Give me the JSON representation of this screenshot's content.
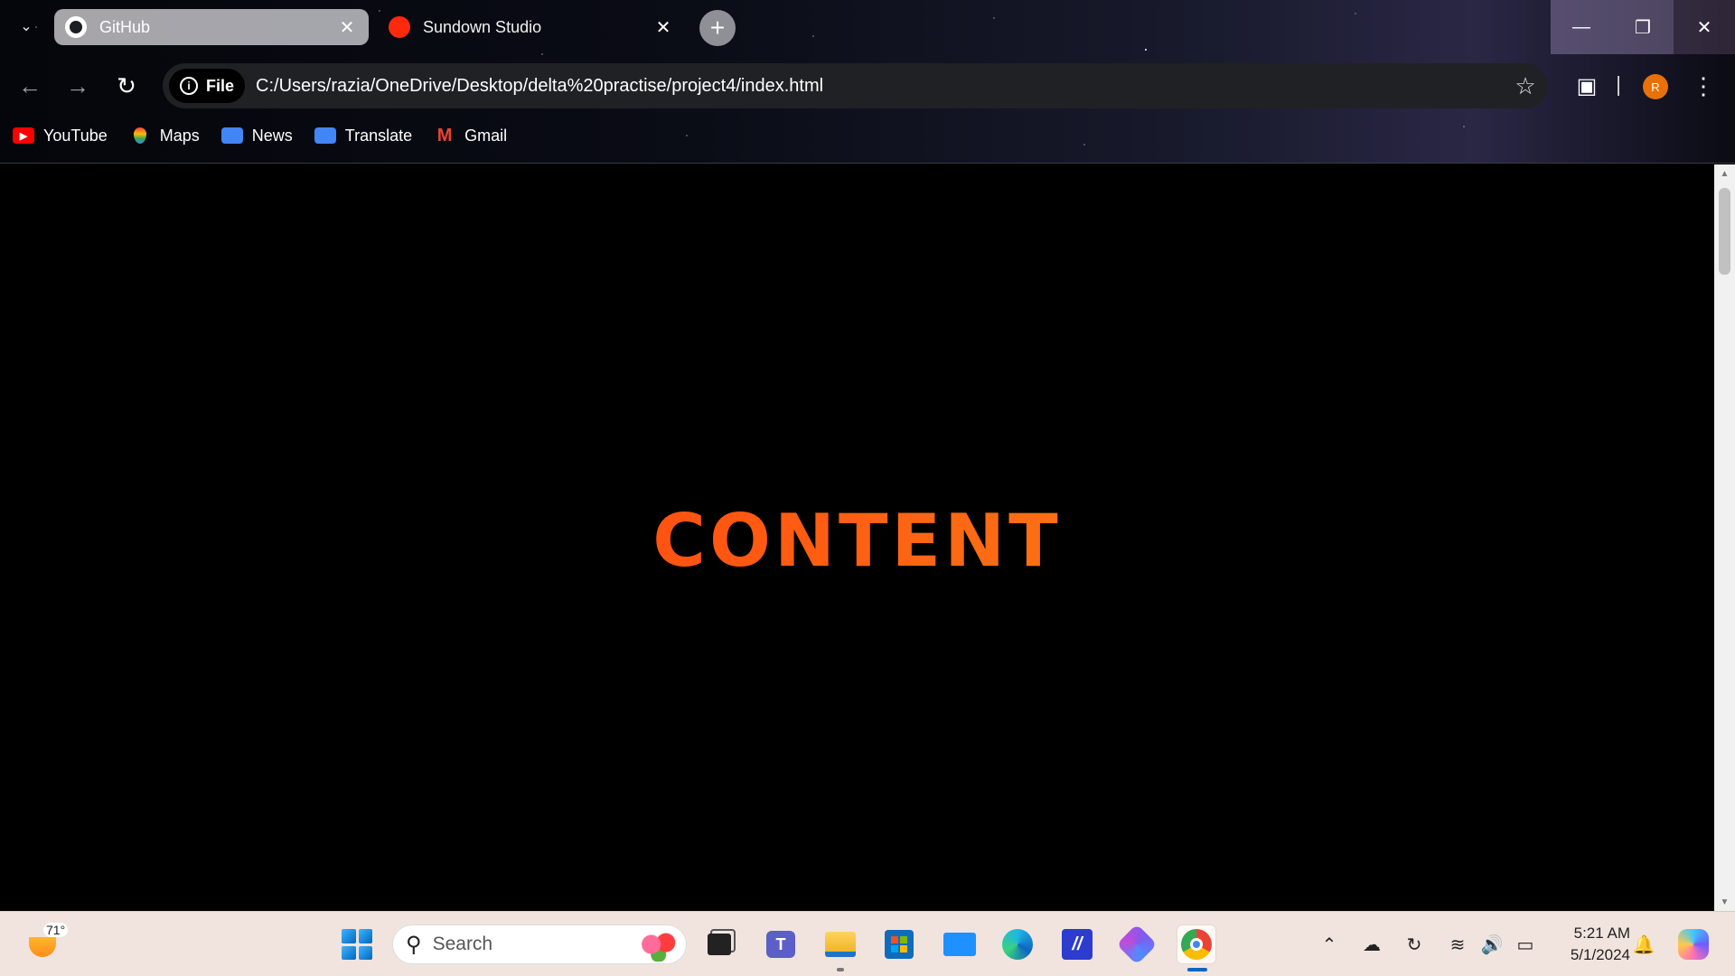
{
  "browser": {
    "tabs": [
      {
        "title": "GitHub",
        "active": true,
        "icon": "github-icon"
      },
      {
        "title": "Sundown Studio",
        "active": false,
        "icon": "red-circle-icon"
      }
    ],
    "address": {
      "scheme_label": "File",
      "url": "C:/Users/razia/OneDrive/Desktop/delta%20practise/project4/index.html"
    },
    "profile_initial": "R",
    "bookmarks": [
      {
        "label": "YouTube",
        "icon": "youtube-icon"
      },
      {
        "label": "Maps",
        "icon": "maps-icon"
      },
      {
        "label": "News",
        "icon": "news-icon"
      },
      {
        "label": "Translate",
        "icon": "translate-icon"
      },
      {
        "label": "Gmail",
        "icon": "gmail-icon"
      }
    ]
  },
  "page": {
    "heading": "CONTENT",
    "heading_gradient": [
      "#ff2a0c",
      "#ff5a12",
      "#f3a21b"
    ],
    "background": "#000000"
  },
  "taskbar": {
    "weather_temp": "71°",
    "search_placeholder": "Search",
    "clock_time": "5:21 AM",
    "clock_date": "5/1/2024",
    "pinned": [
      "task-view",
      "teams",
      "file-explorer",
      "microsoft-store",
      "mail",
      "edge",
      "visual-studio",
      "copilot-app",
      "chrome"
    ]
  }
}
